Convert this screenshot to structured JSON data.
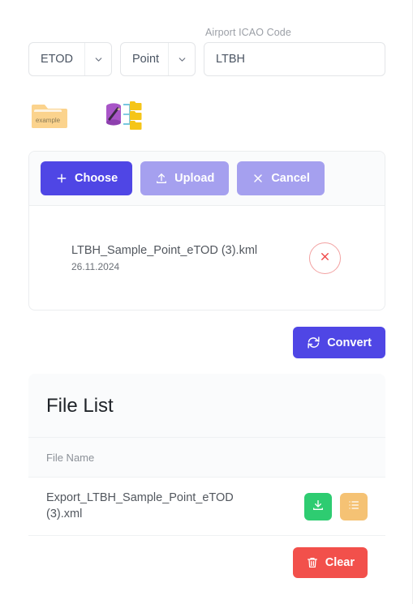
{
  "controls": {
    "dataset_select": {
      "value": "ETOD",
      "icon": "chevron-down-icon"
    },
    "geometry_select": {
      "value": "Point",
      "icon": "chevron-down-icon"
    },
    "icao": {
      "label": "Airport ICAO Code",
      "value": "LTBH",
      "placeholder": "Airport ICAO Code"
    }
  },
  "icon_row": {
    "example_folder": {
      "name": "example-folder-icon",
      "caption": "example"
    },
    "database_to_folders": {
      "name": "database-to-folders-icon"
    }
  },
  "upload_card": {
    "choose_label": "Choose",
    "choose_icon": "plus-icon",
    "upload_label": "Upload",
    "upload_icon": "upload-arrow-icon",
    "cancel_label": "Cancel",
    "cancel_icon": "close-x-icon",
    "file": {
      "name": "LTBH_Sample_Point_eTOD (3).kml",
      "date": "26.11.2024",
      "remove_icon": "close-x-icon"
    }
  },
  "convert": {
    "label": "Convert",
    "icon": "sync-refresh-icon"
  },
  "file_list": {
    "title": "File List",
    "columns": [
      "File Name"
    ],
    "rows": [
      {
        "file_name": "Export_LTBH_Sample_Point_eTOD (3).xml",
        "download_icon": "download-icon",
        "list_icon": "list-lines-icon"
      }
    ],
    "clear_label": "Clear",
    "clear_icon": "trash-icon"
  },
  "colors": {
    "primary": "#4f46e5",
    "primary_muted": "#a5a0ef",
    "success": "#2ecc71",
    "warning": "#f5c274",
    "danger": "#f2504b",
    "remove_outline": "#f2a1a1"
  }
}
